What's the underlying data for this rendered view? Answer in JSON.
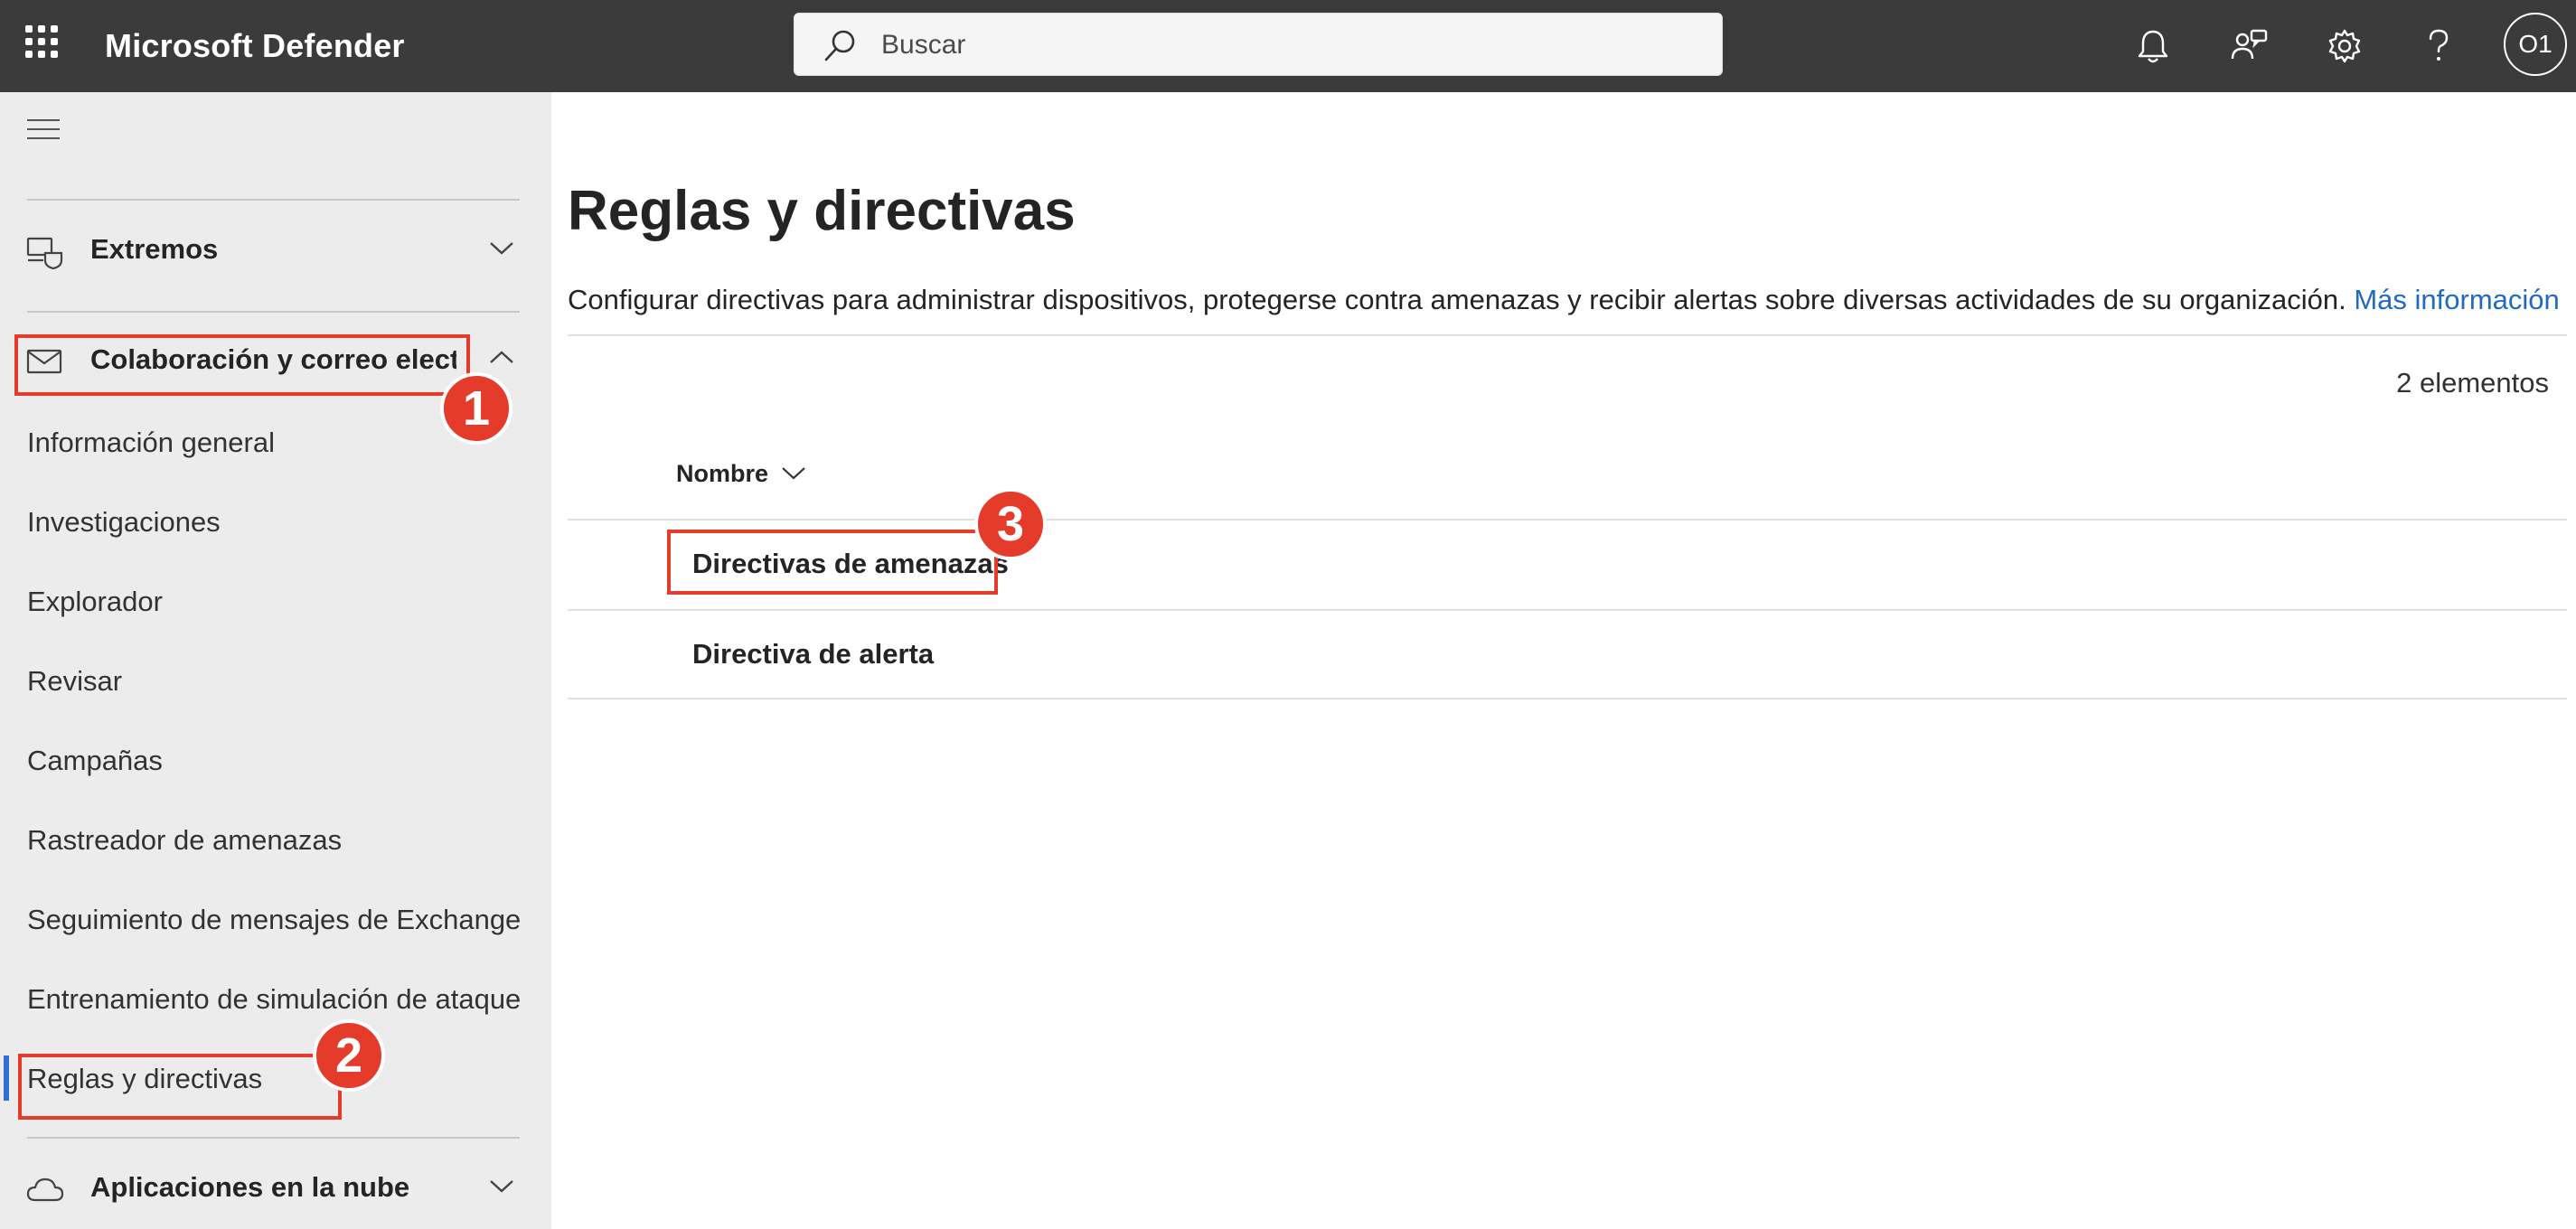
{
  "header": {
    "app_title": "Microsoft Defender",
    "search_placeholder": "Buscar",
    "avatar_initials": "O1",
    "icons": [
      "waffle-icon",
      "bell-icon",
      "community-icon",
      "gear-icon",
      "help-icon"
    ]
  },
  "sidebar": {
    "groups": [
      {
        "label": "Extremos",
        "icon": "devices-icon",
        "expanded": false
      },
      {
        "label": "Colaboración y correo electrónico",
        "icon": "mail-icon",
        "expanded": true
      },
      {
        "label": "Aplicaciones en la nube",
        "icon": "cloud-icon",
        "expanded": false
      }
    ],
    "items": [
      {
        "label": "Información general"
      },
      {
        "label": "Investigaciones"
      },
      {
        "label": "Explorador"
      },
      {
        "label": "Revisar"
      },
      {
        "label": "Campañas"
      },
      {
        "label": "Rastreador de amenazas"
      },
      {
        "label": "Seguimiento de mensajes de Exchange"
      },
      {
        "label": "Entrenamiento de simulación de ataque"
      },
      {
        "label": "Reglas y directivas",
        "active": true
      }
    ]
  },
  "main": {
    "title": "Reglas y directivas",
    "description": "Configurar directivas para administrar dispositivos, protegerse contra amenazas y recibir alertas sobre diversas actividades de su organización.",
    "more_info_link": "Más información",
    "item_count": "2 elementos",
    "column_header": "Nombre",
    "rows": [
      {
        "name": "Directivas de amenazas"
      },
      {
        "name": "Directiva de alerta"
      }
    ]
  },
  "annotations": {
    "badges": [
      "1",
      "2",
      "3"
    ],
    "color": "#e53b2a"
  },
  "colors": {
    "topbar": "#3b3b3b",
    "sidebar": "#ececec",
    "accent": "#2f6fd6",
    "link": "#1f6bc1"
  }
}
